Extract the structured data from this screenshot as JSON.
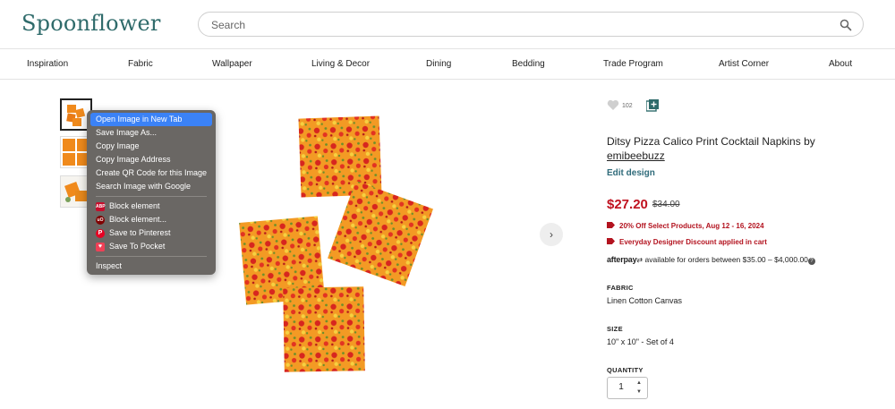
{
  "header": {
    "logo": "Spoonflower",
    "search_placeholder": "Search"
  },
  "nav": {
    "items": [
      "Inspiration",
      "Fabric",
      "Wallpaper",
      "Living & Decor",
      "Dining",
      "Bedding",
      "Trade Program",
      "Artist Corner",
      "About"
    ]
  },
  "gallery": {
    "next_label": "›"
  },
  "context_menu": {
    "items": [
      {
        "label": "Open Image in New Tab",
        "highlighted": true
      },
      {
        "label": "Save Image As..."
      },
      {
        "label": "Copy Image"
      },
      {
        "label": "Copy Image Address"
      },
      {
        "label": "Create QR Code for this Image"
      },
      {
        "label": "Search Image with Google"
      },
      {
        "label": "Block element",
        "icon": "adblock-plus-icon"
      },
      {
        "label": "Block element...",
        "icon": "ublock-origin-icon"
      },
      {
        "label": "Save to Pinterest",
        "icon": "pinterest-icon"
      },
      {
        "label": "Save To Pocket",
        "icon": "pocket-icon"
      },
      {
        "label": "Inspect"
      }
    ],
    "icon_texts": {
      "abp": "ABP",
      "ub": "uO",
      "pin": "P",
      "pocket": "♥"
    }
  },
  "product": {
    "likes": "102",
    "title": "Ditsy Pizza Calico Print Cocktail Napkins by",
    "author": "emibeebuzz",
    "edit_link": "Edit design",
    "price": "$27.20",
    "original_price": "$34.00",
    "promo_1": "20% Off Select Products, Aug 12 - 16, 2024",
    "promo_2": "Everyday Designer Discount applied in cart",
    "afterpay_brand": "afterpay",
    "afterpay_text": "available for orders between $35.00 – $4,000.00",
    "afterpay_help": "?",
    "fabric_label": "FABRIC",
    "fabric_value": "Linen Cotton Canvas",
    "size_label": "SIZE",
    "size_value": "10\" x 10\" - Set of 4",
    "quantity_label": "QUANTITY",
    "quantity_value": "1"
  },
  "colors": {
    "brand": "#2f6b6b",
    "sale_red": "#c0111f",
    "menu_bg": "#6a6764",
    "menu_highlight": "#3b82f6",
    "napkin_orange": "#f08a1c"
  }
}
